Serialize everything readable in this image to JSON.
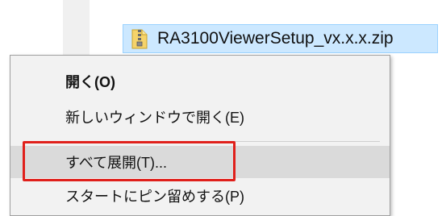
{
  "file": {
    "name": "RA3100ViewerSetup_vx.x.x.zip",
    "icon": "zip-folder-icon"
  },
  "context_menu": {
    "items": [
      {
        "label": "開く(O)",
        "bold": true
      },
      {
        "label": "新しいウィンドウで開く(E)"
      },
      {
        "label": "すべて展開(T)...",
        "highlighted": true
      },
      {
        "label": "スタートにピン留めする(P)"
      }
    ]
  },
  "colors": {
    "selection_bg": "#cce8ff",
    "menu_bg": "#f2f2f2",
    "hover_bg": "#dadada",
    "annotation": "#e0201b"
  }
}
